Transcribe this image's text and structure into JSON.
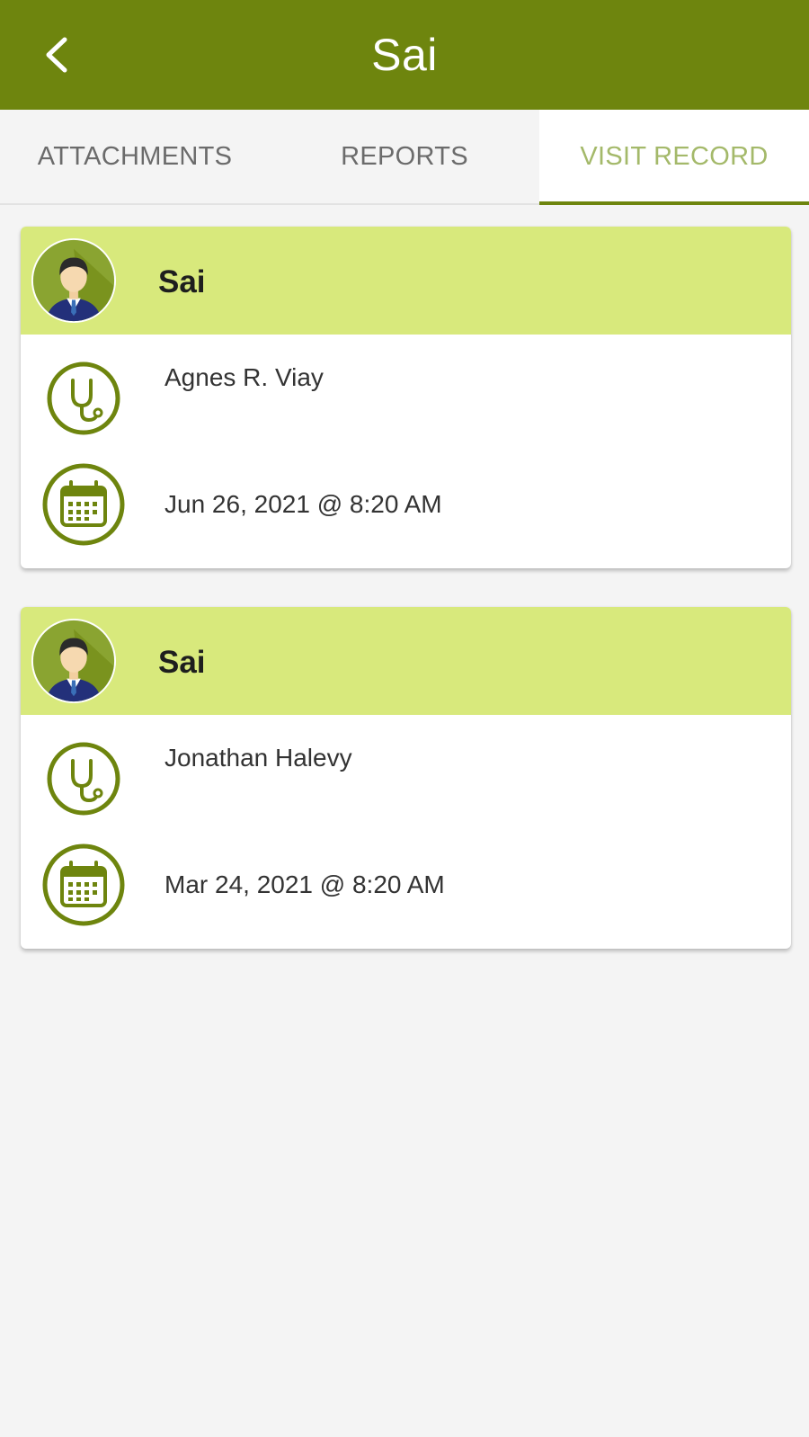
{
  "header": {
    "title": "Sai",
    "back_icon": "chevron-left-icon",
    "color": "#6e850e"
  },
  "tabs": [
    {
      "label": "ATTACHMENTS",
      "active": false
    },
    {
      "label": "REPORTS",
      "active": false
    },
    {
      "label": "VISIT RECORD",
      "active": true
    }
  ],
  "visits": [
    {
      "patient_name": "Sai",
      "avatar_icon": "user-avatar-icon",
      "doctor_icon": "stethoscope-icon",
      "doctor": "Agnes R. Viay",
      "date_icon": "calendar-icon",
      "date": "Jun 26, 2021 @ 8:20 AM"
    },
    {
      "patient_name": "Sai",
      "avatar_icon": "user-avatar-icon",
      "doctor_icon": "stethoscope-icon",
      "doctor": "Jonathan Halevy",
      "date_icon": "calendar-icon",
      "date": "Mar 24, 2021 @ 8:20 AM"
    }
  ],
  "colors": {
    "accent": "#6e850e",
    "card_header": "#d8e97c",
    "active_tab_text": "#a4b96a"
  }
}
